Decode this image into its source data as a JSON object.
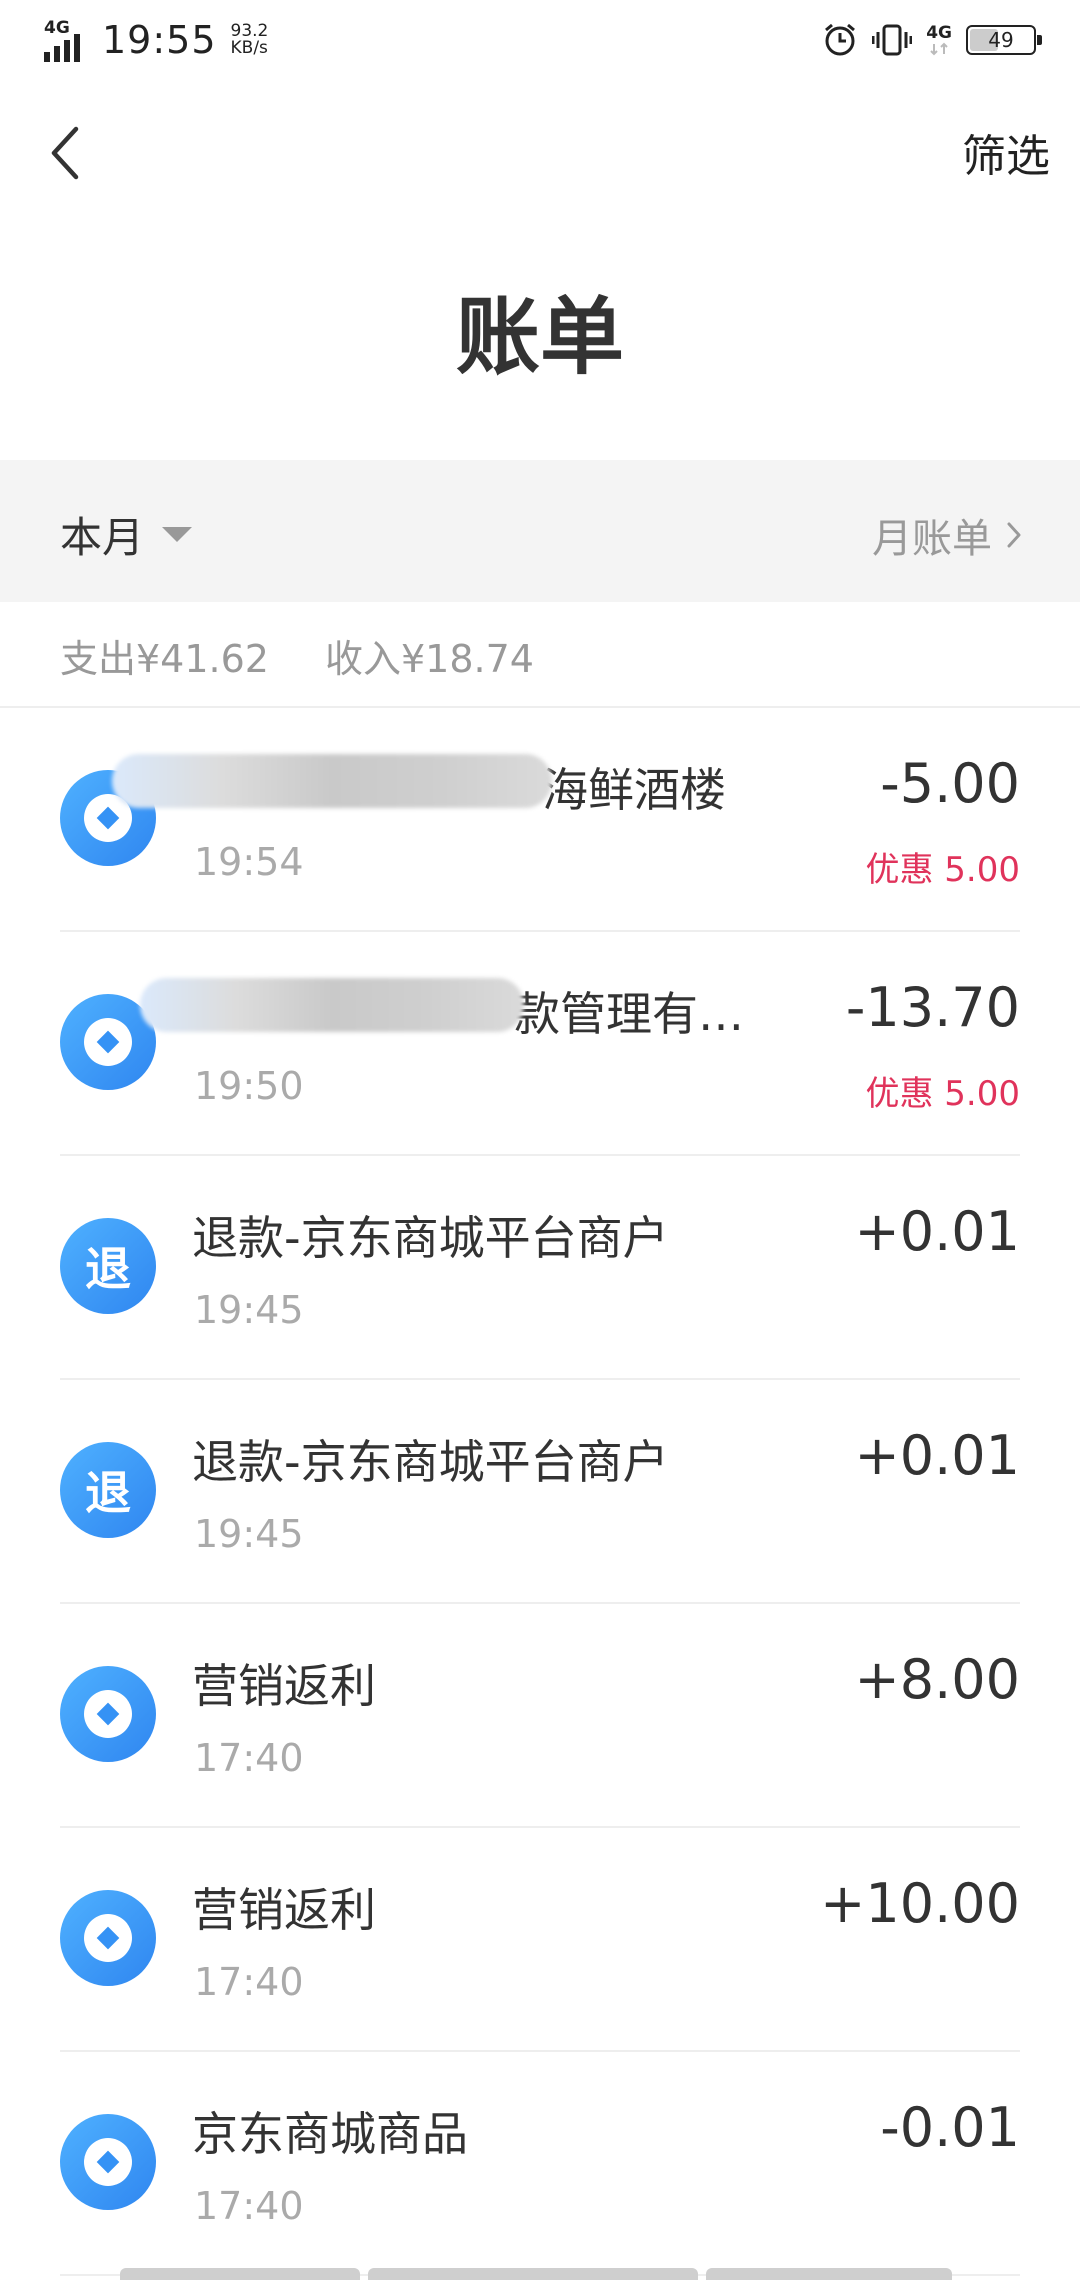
{
  "status_bar": {
    "network_label": "4G",
    "time": "19:55",
    "speed_value": "93.2",
    "speed_unit": "KB/s",
    "network_label_right": "4G",
    "battery": "49",
    "battery_level": 0.49,
    "icons": [
      "signal-icon",
      "alarm-icon",
      "vibrate-icon",
      "network-4g-icon",
      "battery-icon"
    ]
  },
  "nav": {
    "back_icon": "back-chevron-icon",
    "filter_label": "筛选"
  },
  "title": "账单",
  "month_bar": {
    "period_label": "本月",
    "monthly_bill_label": "月账单"
  },
  "summary": {
    "expense": "支出¥41.62",
    "income": "收入¥18.74"
  },
  "transactions": [
    {
      "icon": "coin-icon",
      "name": "海鲜酒楼",
      "time": "19:54",
      "amount": "-5.00",
      "discount": "优惠 5.00"
    },
    {
      "icon": "coin-icon",
      "name": "款管理有…",
      "time": "19:50",
      "amount": "-13.70",
      "discount": "优惠 5.00"
    },
    {
      "icon": "refund-icon",
      "icon_text": "退",
      "name": "退款-京东商城平台商户",
      "time": "19:45",
      "amount": "+0.01"
    },
    {
      "icon": "refund-icon",
      "icon_text": "退",
      "name": "退款-京东商城平台商户",
      "time": "19:45",
      "amount": "+0.01"
    },
    {
      "icon": "coin-icon",
      "name": "营销返利",
      "time": "17:40",
      "amount": "+8.00"
    },
    {
      "icon": "coin-icon",
      "name": "营销返利",
      "time": "17:40",
      "amount": "+10.00"
    },
    {
      "icon": "coin-icon",
      "name": "京东商城商品",
      "time": "17:40",
      "amount": "-0.01"
    }
  ],
  "colors": {
    "icon_blue": "#2f86f0",
    "discount_red": "#e0335b",
    "muted_gray": "#999999"
  }
}
